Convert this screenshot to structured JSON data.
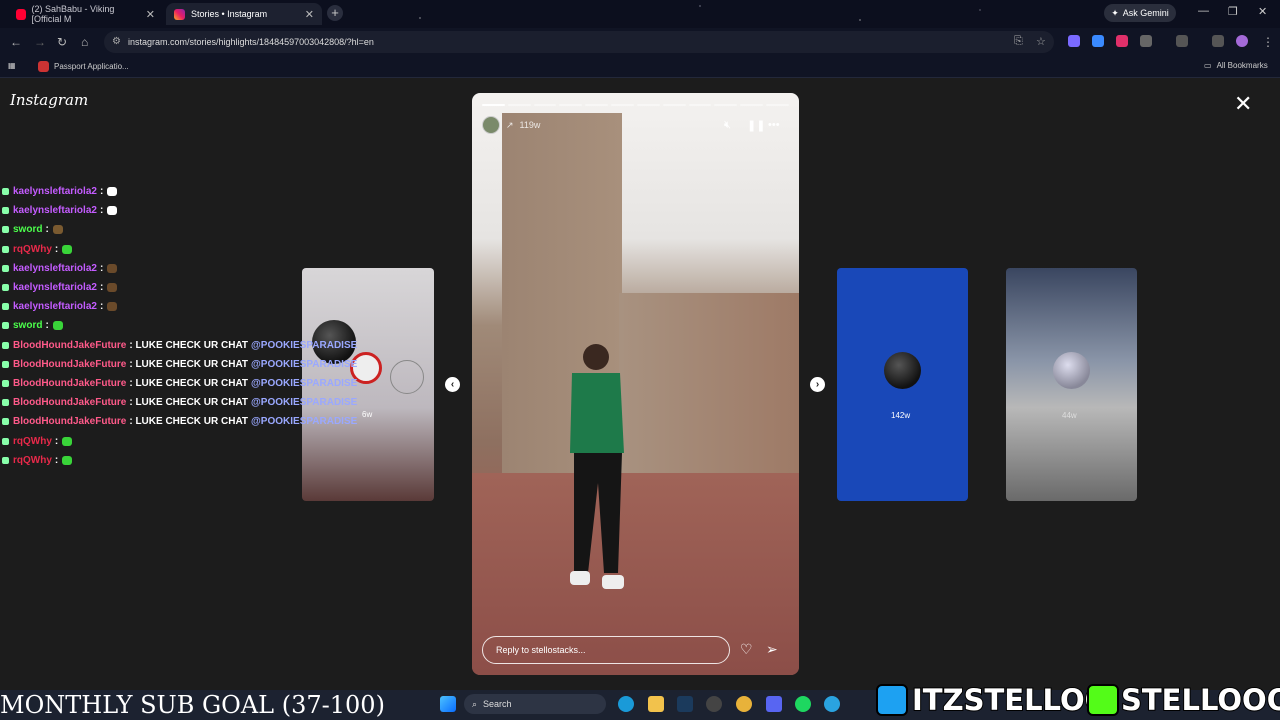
{
  "browser": {
    "tabs": [
      {
        "title": "(2) SahBabu - Viking [Official M",
        "close": "✕"
      },
      {
        "title": "Stories • Instagram",
        "close": "✕"
      }
    ],
    "new_tab": "+",
    "ask_gemini": "Ask Gemini",
    "url": "instagram.com/stories/highlights/18484597003042808/?hl=en",
    "bookmark": "Passport Applicatio...",
    "all_bookmarks": "All Bookmarks"
  },
  "instagram": {
    "logo": "Instagram",
    "close": "✕",
    "prev_story": {
      "age": "6w"
    },
    "current_story": {
      "age": "119w",
      "reply_placeholder": "Reply to stellostacks...",
      "progress_segments": 12,
      "progress_filled": 1
    },
    "next_stories": [
      {
        "age": "142w"
      },
      {
        "age": "44w"
      }
    ],
    "arrows": {
      "left": "‹",
      "right": "›"
    }
  },
  "chat": [
    {
      "user": "kaelynsleftariola2",
      "color": "#c45cff",
      "msg": ":",
      "emote": "#ffffff"
    },
    {
      "user": "kaelynsleftariola2",
      "color": "#c45cff",
      "msg": ":",
      "emote": "#ffffff"
    },
    {
      "user": "sword",
      "color": "#4cff4c",
      "msg": ":",
      "emote": "#7a5a30"
    },
    {
      "user": "rqQWhy",
      "color": "#e8294a",
      "msg": ":",
      "emote": "#39d439"
    },
    {
      "user": "kaelynsleftariola2",
      "color": "#c45cff",
      "msg": ":",
      "emote": "#6a4a2a"
    },
    {
      "user": "kaelynsleftariola2",
      "color": "#c45cff",
      "msg": ":",
      "emote": "#6a4a2a"
    },
    {
      "user": "kaelynsleftariola2",
      "color": "#c45cff",
      "msg": ":",
      "emote": "#6a4a2a"
    },
    {
      "user": "sword",
      "color": "#4cff4c",
      "msg": ":",
      "emote": "#39d439"
    },
    {
      "user": "BloodHoundJakeFuture",
      "color": "#ff5a8a",
      "msg": ": LUKE CHECK UR CHAT",
      "mention": "@POOKIESPARADISE"
    },
    {
      "user": "BloodHoundJakeFuture",
      "color": "#ff5a8a",
      "msg": ": LUKE CHECK UR CHAT",
      "mention": "@POOKIESPARADISE"
    },
    {
      "user": "BloodHoundJakeFuture",
      "color": "#ff5a8a",
      "msg": ": LUKE CHECK UR CHAT",
      "mention": "@POOKIESPARADISE"
    },
    {
      "user": "BloodHoundJakeFuture",
      "color": "#ff5a8a",
      "msg": ": LUKE CHECK UR CHAT",
      "mention": "@POOKIESPARADISE"
    },
    {
      "user": "BloodHoundJakeFuture",
      "color": "#ff5a8a",
      "msg": ": LUKE CHECK UR CHAT",
      "mention": "@POOKIESPARADISE"
    },
    {
      "user": "rqQWhy",
      "color": "#e8294a",
      "msg": ":",
      "emote": "#39d439"
    },
    {
      "user": "rqQWhy",
      "color": "#e8294a",
      "msg": ":",
      "emote": "#39d439"
    }
  ],
  "stream": {
    "sub_goal": "MONTHLY SUB GOAL (37-100)",
    "twitter_handle": "ITZSTELLOO",
    "kick_handle": "STELLOOO"
  },
  "taskbar": {
    "search": "Search"
  }
}
